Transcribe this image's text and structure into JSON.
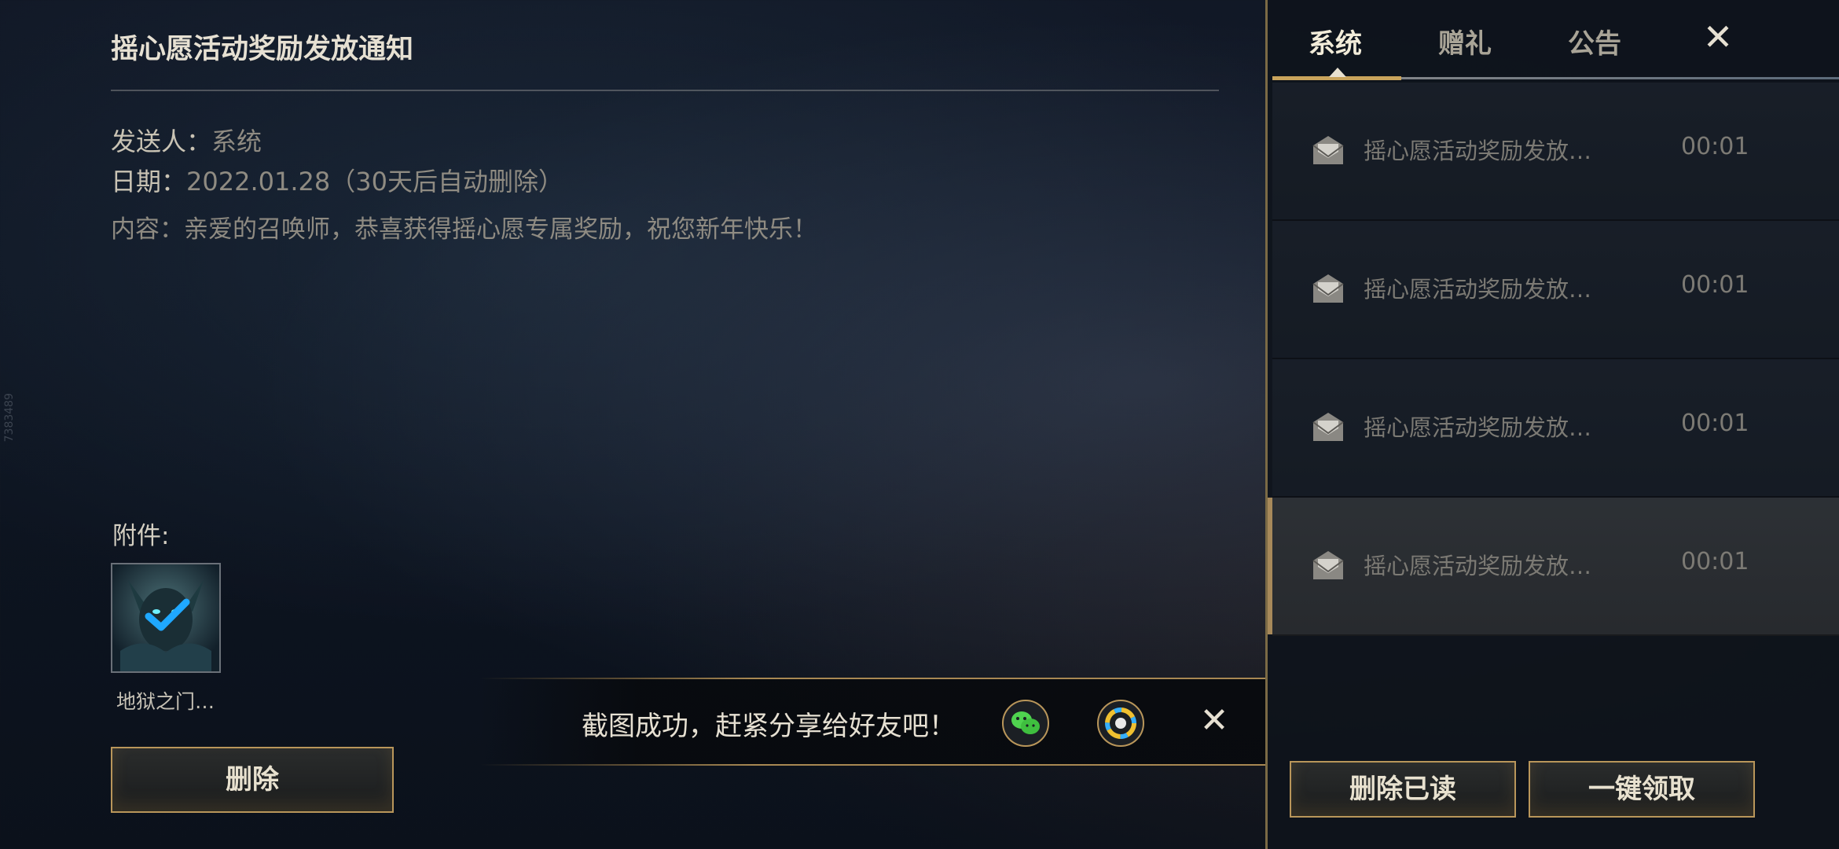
{
  "detail": {
    "title": "摇心愿活动奖励发放通知",
    "sender_label": "发送人：",
    "sender_value": "系统",
    "date_label": "日期：",
    "date_value": "2022.01.28（30天后自动删除）",
    "content_label": "内容：",
    "content_value": "亲爱的召唤师，恭喜获得摇心愿专属奖励，祝您新年快乐！",
    "attachments_label": "附件:",
    "attachment": {
      "name": "地狱之门…",
      "claimed": true
    },
    "delete_button": "删除"
  },
  "toast": {
    "message": "截图成功，赶紧分享给好友吧！",
    "share_targets": [
      "wechat-icon",
      "moments-icon"
    ]
  },
  "sidebar": {
    "tabs": [
      {
        "label": "系统",
        "active": true
      },
      {
        "label": "赠礼",
        "active": false
      },
      {
        "label": "公告",
        "active": false
      }
    ],
    "mails": [
      {
        "subject": "摇心愿活动奖励发放…",
        "time": "00:01",
        "selected": false
      },
      {
        "subject": "摇心愿活动奖励发放…",
        "time": "00:01",
        "selected": false
      },
      {
        "subject": "摇心愿活动奖励发放…",
        "time": "00:01",
        "selected": false
      },
      {
        "subject": "摇心愿活动奖励发放…",
        "time": "00:01",
        "selected": true
      }
    ],
    "delete_read_button": "删除已读",
    "claim_all_button": "一键领取"
  },
  "side_watermark": "7383489",
  "colors": {
    "gold_accent": "#b9965a",
    "active_tab_underline": "#c9a45c",
    "text_primary": "#e6e0d2",
    "text_muted": "#8f8b82"
  }
}
